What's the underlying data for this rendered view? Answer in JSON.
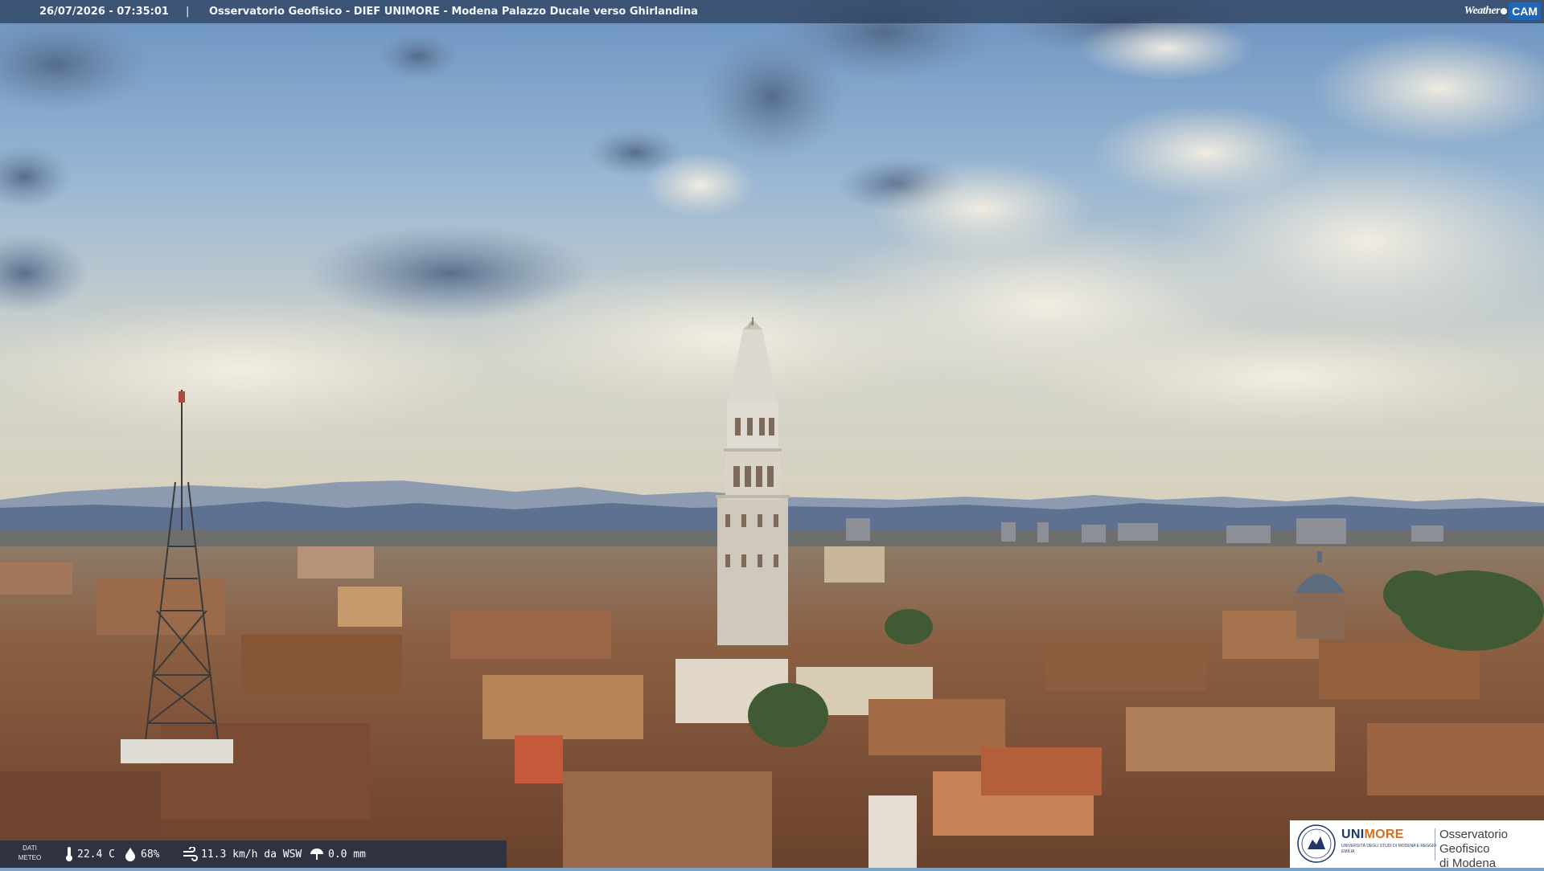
{
  "overlay": {
    "timestamp": "26/07/2026 - 07:35:01",
    "separator": "|",
    "title": "Osservatorio Geofisico - DIEF UNIMORE - Modena Palazzo Ducale verso Ghirlandina"
  },
  "brand": {
    "weather": "Weather",
    "cam": "CAM"
  },
  "meteo": {
    "label_line1": "DATI",
    "label_line2": "METEO",
    "temperature": "22.4 C",
    "humidity": "68%",
    "wind": "11.3 km/h da WSW",
    "rain": "0.0 mm"
  },
  "logo": {
    "uni_part1": "UNI",
    "uni_part2": "MORE",
    "uni_subtitle": "Università degli Studi di Modena e Reggio Emilia",
    "observatory_line1": "Osservatorio Geofisico",
    "observatory_line2": "di Modena"
  },
  "colors": {
    "sky_top": "#6f97c4",
    "sky_horizon": "#d9d6c6",
    "mountains": "#5a6f8c",
    "roofs": "#8a5a3c",
    "tower": "#d8d4cc",
    "unimore_blue": "#1f3763",
    "unimore_orange": "#d96b1c"
  },
  "icons": [
    "thermometer-icon",
    "humidity-drop-icon",
    "wind-icon",
    "rain-icon",
    "wifi-cam-icon"
  ]
}
